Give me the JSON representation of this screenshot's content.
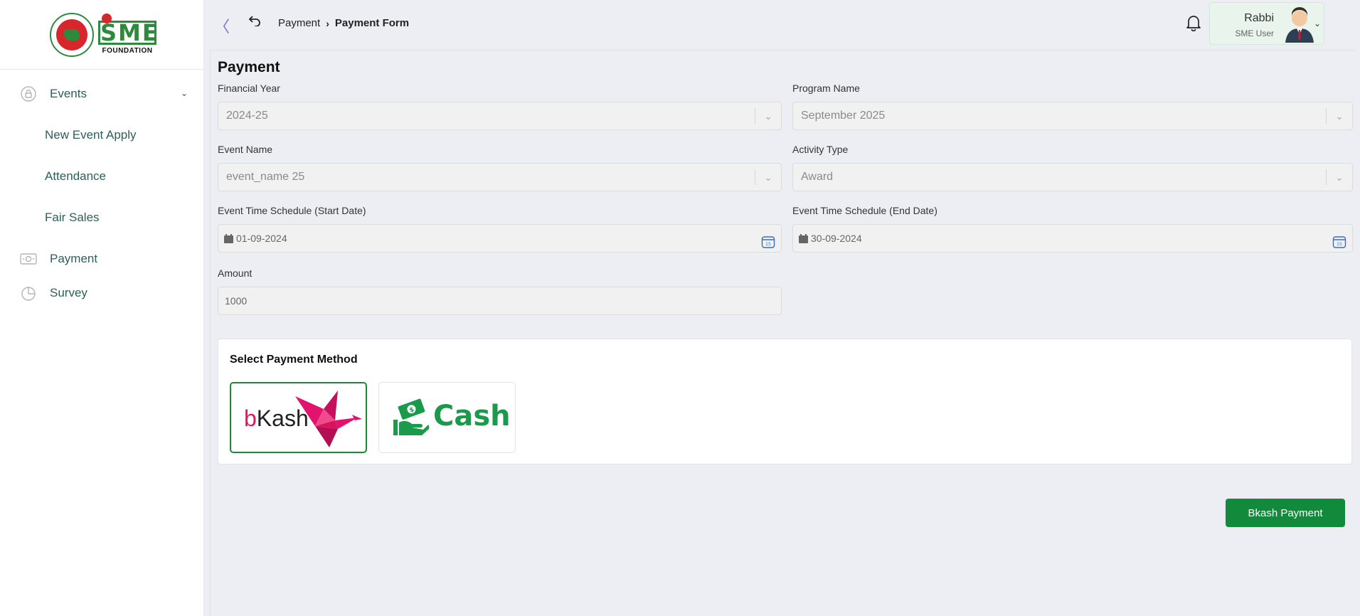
{
  "sidebar": {
    "logo": {
      "brand_letters": "SME",
      "foundation": "FOUNDATION"
    },
    "items": [
      {
        "label": "Events",
        "icon": "lock-circle-icon",
        "expanded": true
      },
      {
        "label": "New Event Apply"
      },
      {
        "label": "Attendance"
      },
      {
        "label": "Fair Sales"
      },
      {
        "label": "Payment",
        "icon": "money-icon"
      },
      {
        "label": "Survey",
        "icon": "pie-chart-icon"
      }
    ]
  },
  "header": {
    "breadcrumb": {
      "parent": "Payment",
      "current": "Payment Form"
    },
    "user": {
      "name": "Rabbi",
      "role": "SME User"
    }
  },
  "form": {
    "title": "Payment",
    "financial_year": {
      "label": "Financial Year",
      "value": "2024-25"
    },
    "program_name": {
      "label": "Program Name",
      "value": "September 2025"
    },
    "event_name": {
      "label": "Event Name",
      "value": "event_name 25"
    },
    "activity_type": {
      "label": "Activity Type",
      "value": "Award"
    },
    "start_date": {
      "label": "Event Time Schedule (Start Date)",
      "value": "01-09-2024"
    },
    "end_date": {
      "label": "Event Time Schedule (End Date)",
      "value": "30-09-2024"
    },
    "amount": {
      "label": "Amount",
      "value": "1000"
    }
  },
  "payment_methods": {
    "title": "Select Payment Method",
    "options": [
      {
        "id": "bkash",
        "label_b": "b",
        "label_rest": "Kash",
        "selected": true
      },
      {
        "id": "cash",
        "label": "Cash",
        "selected": false
      }
    ]
  },
  "submit": {
    "label": "Bkash Payment"
  },
  "colors": {
    "primary": "#118a3c",
    "bkash": "#e2136e",
    "nav_text": "#2d5f5a",
    "accent": "#7b6cd6"
  }
}
